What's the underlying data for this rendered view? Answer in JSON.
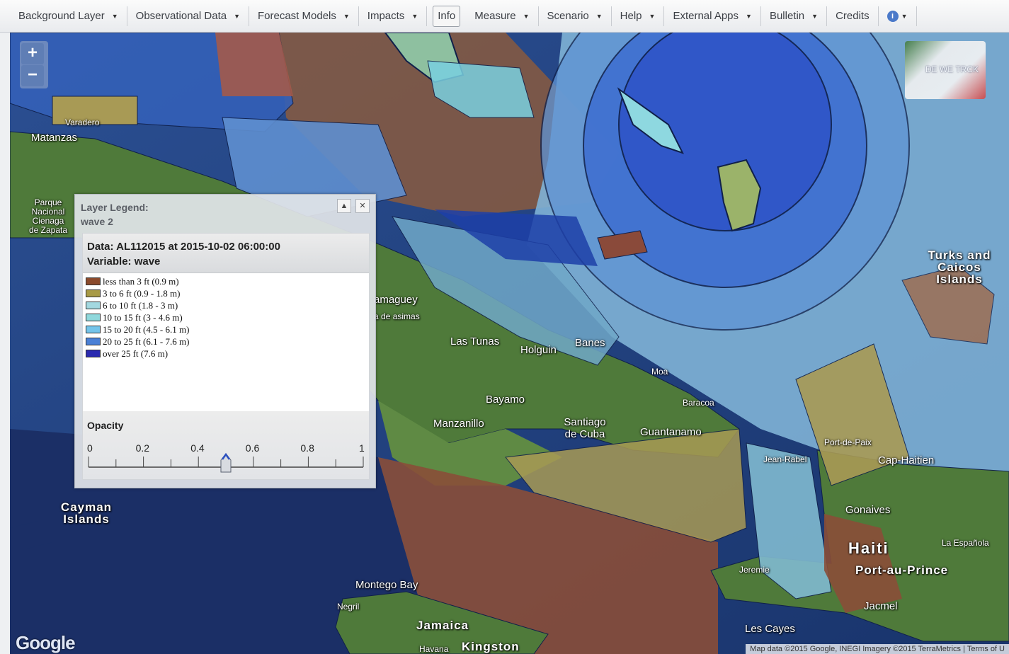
{
  "menu": {
    "items": [
      {
        "label": "Background Layer",
        "caret": true
      },
      {
        "label": "Observational Data",
        "caret": true
      },
      {
        "label": "Forecast Models",
        "caret": true
      },
      {
        "label": "Impacts",
        "caret": true
      },
      {
        "label": "Info",
        "caret": false
      },
      {
        "label": "Measure",
        "caret": true
      },
      {
        "label": "Scenario",
        "caret": true
      },
      {
        "label": "Help",
        "caret": true
      },
      {
        "label": "External Apps",
        "caret": true
      },
      {
        "label": "Bulletin",
        "caret": true
      },
      {
        "label": "Credits",
        "caret": false
      }
    ],
    "info_icon": "info-circle-icon"
  },
  "zoom": {
    "in_label": "+",
    "out_label": "−"
  },
  "legend": {
    "title_line1": "Layer Legend:",
    "title_line2": "wave 2",
    "data_line": "Data: AL112015 at 2015-10-02 06:00:00",
    "variable_line": "Variable: wave",
    "items": [
      {
        "label": "less than 3 ft (0.9 m)",
        "color": "#8b4a2c"
      },
      {
        "label": "3 to 6 ft (0.9 - 1.8 m)",
        "color": "#a89a45"
      },
      {
        "label": "6 to 10 ft (1.8 - 3 m)",
        "color": "#a3d8e0"
      },
      {
        "label": "10 to 15 ft (3 - 4.6 m)",
        "color": "#8fd8dc"
      },
      {
        "label": "15 to 20 ft (4.5 - 6.1 m)",
        "color": "#74c4ea"
      },
      {
        "label": "20 to 25 ft (6.1 - 7.6 m)",
        "color": "#4a80d6"
      },
      {
        "label": "over 25 ft (7.6 m)",
        "color": "#2a2ab0"
      }
    ],
    "opacity_label": "Opacity",
    "opacity_ticks": [
      "0",
      "0.2",
      "0.4",
      "0.6",
      "0.8",
      "1"
    ],
    "opacity_value": 0.5,
    "collapse_icon": "collapse-up-icon",
    "close_icon": "close-icon"
  },
  "places": [
    {
      "label": "Varadero"
    },
    {
      "label": "Matanzas"
    },
    {
      "label": "Parque Nacional Cienaga de Zapata"
    },
    {
      "label": "amaguey"
    },
    {
      "label": "a de asimas"
    },
    {
      "label": "Las Tunas"
    },
    {
      "label": "Holguin"
    },
    {
      "label": "Banes"
    },
    {
      "label": "Moa"
    },
    {
      "label": "Bayamo"
    },
    {
      "label": "Baracoa"
    },
    {
      "label": "Manzanillo"
    },
    {
      "label": "Santiago de Cuba"
    },
    {
      "label": "Guantanamo"
    },
    {
      "label": "Turks and Caicos Islands"
    },
    {
      "label": "Port-de-Paix"
    },
    {
      "label": "Jean-Rabel"
    },
    {
      "label": "Cap-Haitien"
    },
    {
      "label": "Gonaives"
    },
    {
      "label": "Haiti"
    },
    {
      "label": "La Española"
    },
    {
      "label": "Port-au-Prince"
    },
    {
      "label": "Jeremie"
    },
    {
      "label": "Jacmel"
    },
    {
      "label": "Les Cayes"
    },
    {
      "label": "Cayman Islands"
    },
    {
      "label": "Montego Bay"
    },
    {
      "label": "Negril"
    },
    {
      "label": "Jamaica"
    },
    {
      "label": "Havana"
    },
    {
      "label": "Kingston"
    }
  ],
  "logo_text": "DE WE TRCK",
  "google_label": "Google",
  "attribution": "Map data ©2015 Google, INEGI Imagery ©2015 TerraMetrics | Terms of U"
}
